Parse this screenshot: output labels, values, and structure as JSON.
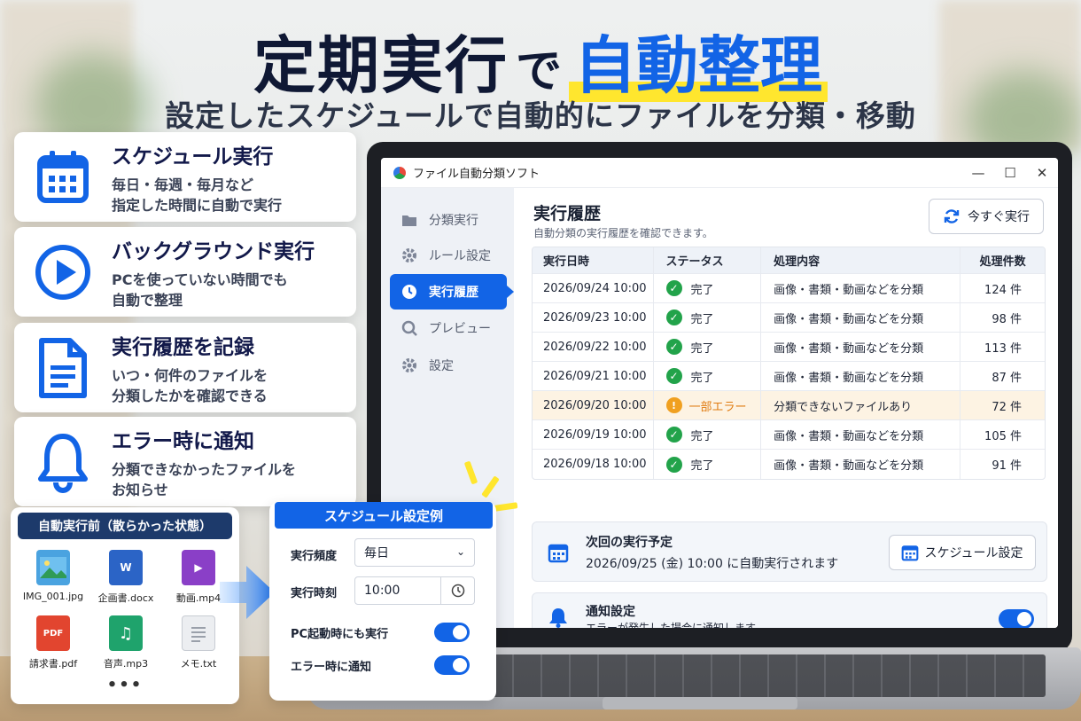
{
  "headline": {
    "part1": "定期実行",
    "connector": "で",
    "accent": "自動整理",
    "subtitle": "設定したスケジュールで自動的にファイルを分類・移動"
  },
  "features": [
    {
      "icon": "calendar-icon",
      "title": "スケジュール実行",
      "desc1": "毎日・毎週・毎月など",
      "desc2": "指定した時間に自動で実行"
    },
    {
      "icon": "play-icon",
      "title": "バックグラウンド実行",
      "desc1": "PCを使っていない時間でも",
      "desc2": "自動で整理"
    },
    {
      "icon": "document-icon",
      "title": "実行履歴を記録",
      "desc1": "いつ・何件のファイルを",
      "desc2": "分類したかを確認できる"
    },
    {
      "icon": "bell-icon",
      "title": "エラー時に通知",
      "desc1": "分類できなかったファイルを",
      "desc2": "お知らせ"
    }
  ],
  "app": {
    "title": "ファイル自動分類ソフト",
    "window_buttons": [
      "—",
      "☐",
      "✕"
    ],
    "nav": [
      {
        "label": "分類実行",
        "icon": "folder-icon"
      },
      {
        "label": "ルール設定",
        "icon": "gear-icon"
      },
      {
        "label": "実行履歴",
        "icon": "clock-icon",
        "active": true
      },
      {
        "label": "プレビュー",
        "icon": "preview-icon"
      },
      {
        "label": "設定",
        "icon": "settings-icon"
      }
    ],
    "main_title": "実行履歴",
    "main_subtitle": "自動分類の実行履歴を確認できます。",
    "run_now_label": "今すぐ実行",
    "table": {
      "headers": [
        "実行日時",
        "ステータス",
        "処理内容",
        "処理件数"
      ],
      "rows": [
        {
          "datetime": "2026/09/24 10:00",
          "status": "完了",
          "content": "画像・書類・動画などを分類",
          "count": "124 件",
          "warn": false
        },
        {
          "datetime": "2026/09/23 10:00",
          "status": "完了",
          "content": "画像・書類・動画などを分類",
          "count": "98 件",
          "warn": false
        },
        {
          "datetime": "2026/09/22 10:00",
          "status": "完了",
          "content": "画像・書類・動画などを分類",
          "count": "113 件",
          "warn": false
        },
        {
          "datetime": "2026/09/21 10:00",
          "status": "完了",
          "content": "画像・書類・動画などを分類",
          "count": "87 件",
          "warn": false
        },
        {
          "datetime": "2026/09/20 10:00",
          "status": "一部エラー",
          "content": "分類できないファイルあり",
          "count": "72 件",
          "warn": true
        },
        {
          "datetime": "2026/09/19 10:00",
          "status": "完了",
          "content": "画像・書類・動画などを分類",
          "count": "105 件",
          "warn": false
        },
        {
          "datetime": "2026/09/18 10:00",
          "status": "完了",
          "content": "画像・書類・動画などを分類",
          "count": "91 件",
          "warn": false
        }
      ]
    },
    "next_run": {
      "title": "次回の実行予定",
      "desc": "2026/09/25 (金) 10:00 に自動実行されます",
      "button": "スケジュール設定"
    },
    "notify": {
      "title": "通知設定",
      "desc": "エラーが発生した場合に通知します",
      "enabled": true
    }
  },
  "before": {
    "title": "自動実行前（散らかった状態）",
    "files": [
      {
        "name": "IMG_001.jpg",
        "icon": "image-file-icon"
      },
      {
        "name": "企画書.docx",
        "icon": "word-file-icon"
      },
      {
        "name": "動画.mp4",
        "icon": "video-file-icon"
      },
      {
        "name": "請求書.pdf",
        "icon": "pdf-file-icon"
      },
      {
        "name": "音声.mp3",
        "icon": "audio-file-icon"
      },
      {
        "name": "メモ.txt",
        "icon": "text-file-icon"
      }
    ],
    "more": "•••"
  },
  "schedule_example": {
    "title": "スケジュール設定例",
    "frequency_label": "実行頻度",
    "frequency_value": "毎日",
    "time_label": "実行時刻",
    "time_value": "10:00",
    "startup_label": "PC起動時にも実行",
    "startup_enabled": true,
    "error_label": "エラー時に通知",
    "error_enabled": true
  },
  "colors": {
    "accent": "#1264e6",
    "navy": "#12194a",
    "ok": "#22a34a",
    "warn": "#f0a020",
    "highlight": "#ffe62e"
  }
}
